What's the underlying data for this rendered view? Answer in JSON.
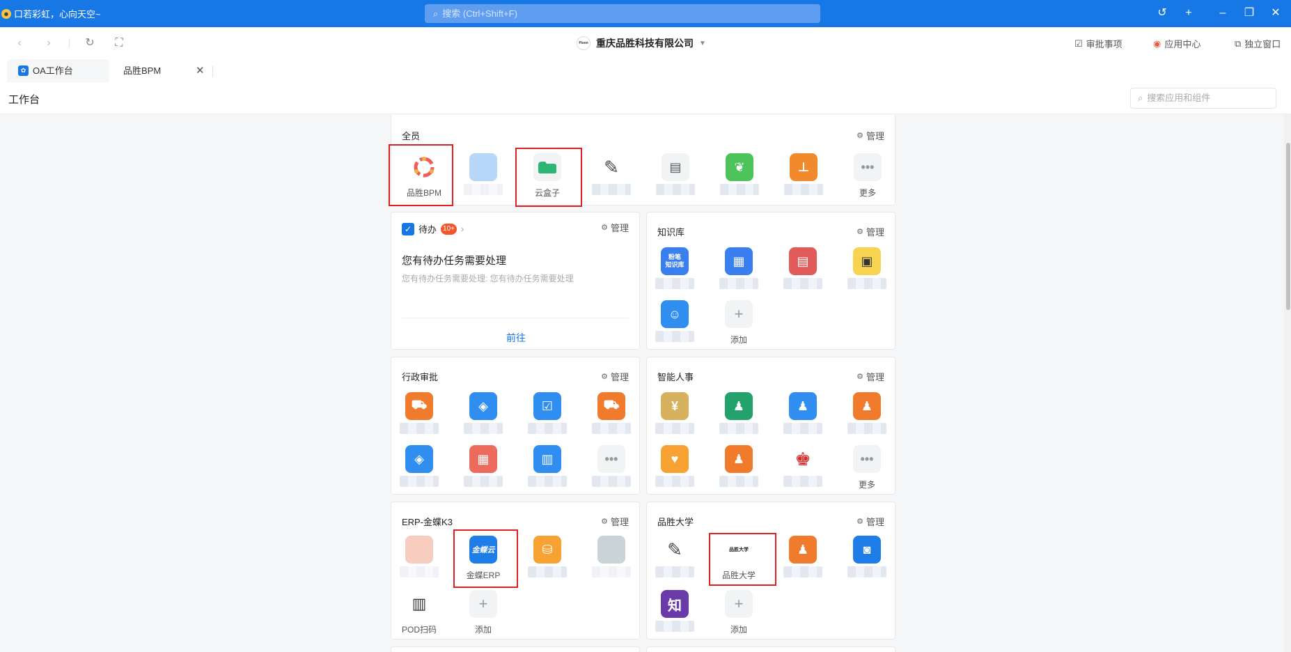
{
  "titlebar": {
    "status_text": "口若彩虹，心向天空~",
    "search_placeholder": "搜索 (Ctrl+Shift+F)"
  },
  "navbar": {
    "company": "重庆品胜科技有限公司",
    "company_logo_text": "Pisen",
    "links": [
      "审批事项",
      "应用中心",
      "独立窗口"
    ]
  },
  "tabs": [
    {
      "label": "OA工作台",
      "active": true
    },
    {
      "label": "品胜BPM",
      "active": false
    }
  ],
  "page": {
    "title": "工作台",
    "search_placeholder": "搜索应用和组件"
  },
  "manage_label": "管理",
  "cards": {
    "all": {
      "title": "全员",
      "apps": [
        {
          "label": "品胜BPM",
          "icon": "bpm-ring-icon"
        },
        {
          "label": "",
          "icon": "blurred-app-icon"
        },
        {
          "label": "云盒子",
          "icon": "cloud-folder-icon"
        },
        {
          "label": "",
          "icon": "scribble-icon"
        },
        {
          "label": "",
          "icon": "presentation-icon"
        },
        {
          "label": "",
          "icon": "feather-icon"
        },
        {
          "label": "",
          "icon": "stamp-icon"
        },
        {
          "label": "更多",
          "icon": "more-icon"
        }
      ]
    },
    "todo": {
      "title": "待办",
      "badge": "10+",
      "heading": "您有待办任务需要处理",
      "subtext": "您有待办任务需要处理: 您有待办任务需要处理",
      "link": "前往"
    },
    "knowledge": {
      "title": "知识库",
      "icon_text": "粉笔\n知识库",
      "add_label": "添加"
    },
    "admin": {
      "title": "行政审批"
    },
    "hr": {
      "title": "智能人事",
      "more_label": "更多"
    },
    "erp": {
      "title": "ERP-金蝶K3",
      "apps": [
        {
          "label": "",
          "icon": "blurred-app-icon"
        },
        {
          "label": "金蝶ERP",
          "icon_text": "金蝶云"
        },
        {
          "label": "",
          "icon": "database-search-icon"
        },
        {
          "label": "",
          "icon": "blurred-app-icon"
        },
        {
          "label": "POD扫码",
          "icon": "barcode-scan-icon"
        },
        {
          "label": "添加",
          "icon": "plus-icon"
        }
      ]
    },
    "university": {
      "title": "品胜大学",
      "apps": [
        {
          "label": "",
          "icon": "scribble-icon"
        },
        {
          "label": "品胜大学",
          "icon_text": "品胜大学"
        },
        {
          "label": "",
          "icon": "stamp-icon"
        },
        {
          "label": "",
          "icon": "camera-frame-icon"
        },
        {
          "label": "",
          "icon_text": "知"
        },
        {
          "label": "添加",
          "icon": "plus-icon"
        }
      ]
    }
  },
  "colors": {
    "titlebar": "#1677e5",
    "highlight": "#e02020",
    "link": "#1677e5"
  }
}
